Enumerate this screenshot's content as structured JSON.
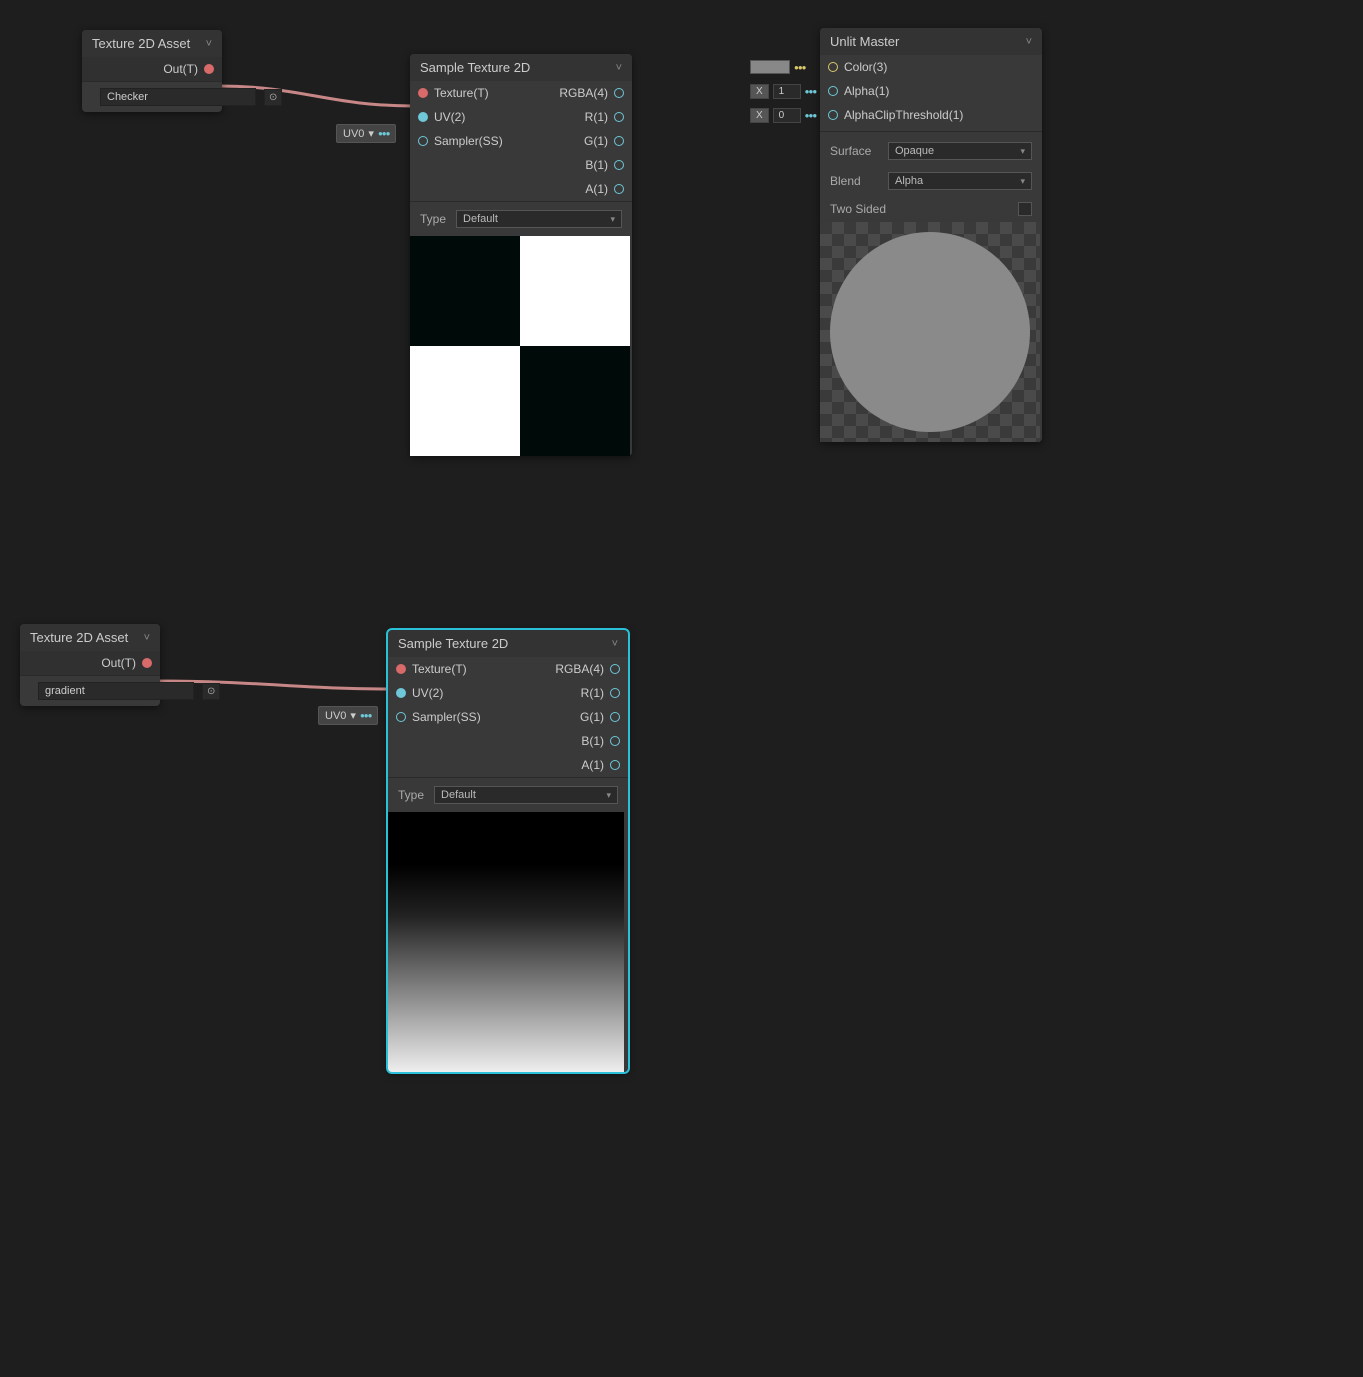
{
  "nodes": {
    "texAsset1": {
      "title": "Texture 2D Asset",
      "out_label": "Out(T)",
      "asset_name": "Checker"
    },
    "texAsset2": {
      "title": "Texture 2D Asset",
      "out_label": "Out(T)",
      "asset_name": "gradient"
    },
    "sample1": {
      "title": "Sample Texture 2D",
      "inputs": {
        "texture": "Texture(T)",
        "uv": "UV(2)",
        "sampler": "Sampler(SS)"
      },
      "outputs": {
        "rgba": "RGBA(4)",
        "r": "R(1)",
        "g": "G(1)",
        "b": "B(1)",
        "a": "A(1)"
      },
      "type_label": "Type",
      "type_value": "Default"
    },
    "sample2": {
      "title": "Sample Texture 2D",
      "inputs": {
        "texture": "Texture(T)",
        "uv": "UV(2)",
        "sampler": "Sampler(SS)"
      },
      "outputs": {
        "rgba": "RGBA(4)",
        "r": "R(1)",
        "g": "G(1)",
        "b": "B(1)",
        "a": "A(1)"
      },
      "type_label": "Type",
      "type_value": "Default"
    },
    "unlit": {
      "title": "Unlit Master",
      "color_label": "Color(3)",
      "alpha_label": "Alpha(1)",
      "alpha_val": "1",
      "clip_label": "AlphaClipThreshold(1)",
      "clip_val": "0",
      "x_badge": "X",
      "surface_label": "Surface",
      "surface_value": "Opaque",
      "blend_label": "Blend",
      "blend_value": "Alpha",
      "twosided_label": "Two Sided"
    }
  },
  "uv_pill": {
    "label": "UV0",
    "arrow": "▾"
  }
}
